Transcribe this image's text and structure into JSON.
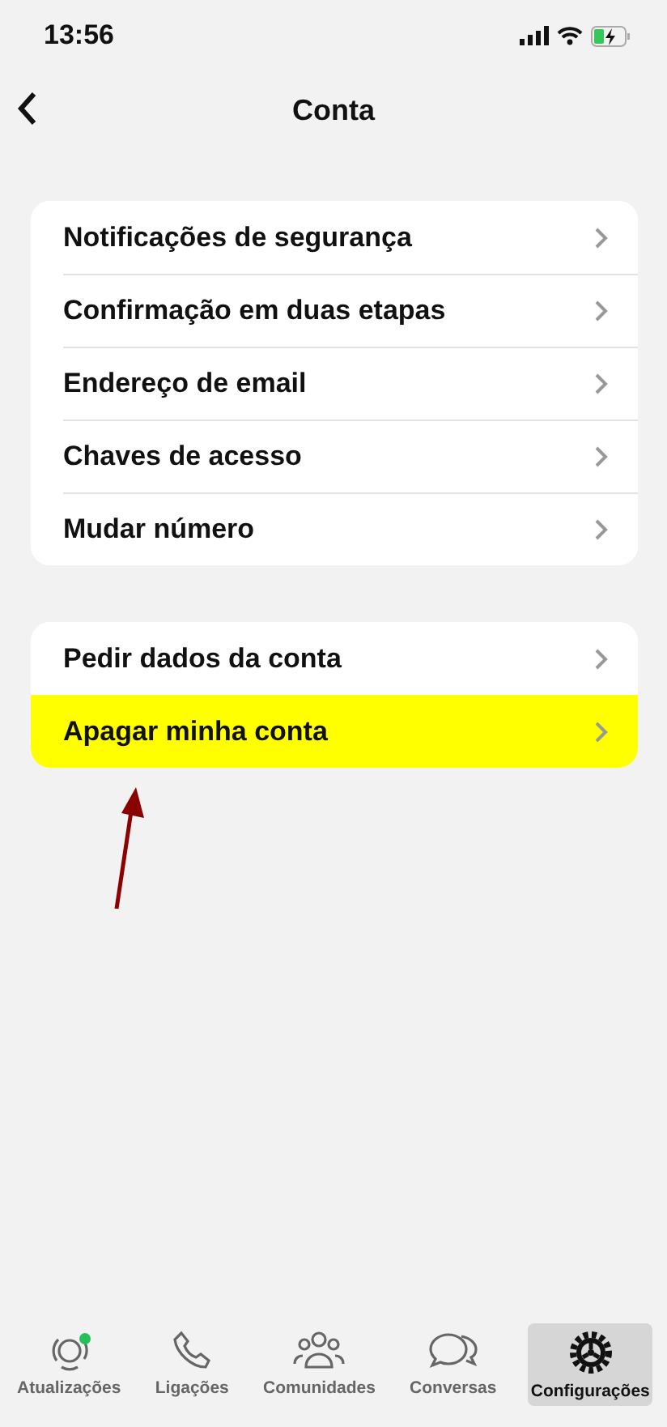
{
  "status_bar": {
    "time": "13:56",
    "battery_charging": true
  },
  "header": {
    "title": "Conta"
  },
  "groups": [
    {
      "items": [
        {
          "label": "Notificações de segurança",
          "highlighted": false
        },
        {
          "label": "Confirmação em duas etapas",
          "highlighted": false
        },
        {
          "label": "Endereço de email",
          "highlighted": false
        },
        {
          "label": "Chaves de acesso",
          "highlighted": false
        },
        {
          "label": "Mudar número",
          "highlighted": false
        }
      ]
    },
    {
      "items": [
        {
          "label": "Pedir dados da conta",
          "highlighted": false
        },
        {
          "label": "Apagar minha conta",
          "highlighted": true
        }
      ]
    }
  ],
  "tab_bar": [
    {
      "kind": "updates",
      "label": "Atualizações",
      "selected": false,
      "badge": true
    },
    {
      "kind": "calls",
      "label": "Ligações",
      "selected": false,
      "badge": false
    },
    {
      "kind": "communities",
      "label": "Comunidades",
      "selected": false,
      "badge": false
    },
    {
      "kind": "chats",
      "label": "Conversas",
      "selected": false,
      "badge": false
    },
    {
      "kind": "settings",
      "label": "Configurações",
      "selected": true,
      "badge": false
    }
  ]
}
